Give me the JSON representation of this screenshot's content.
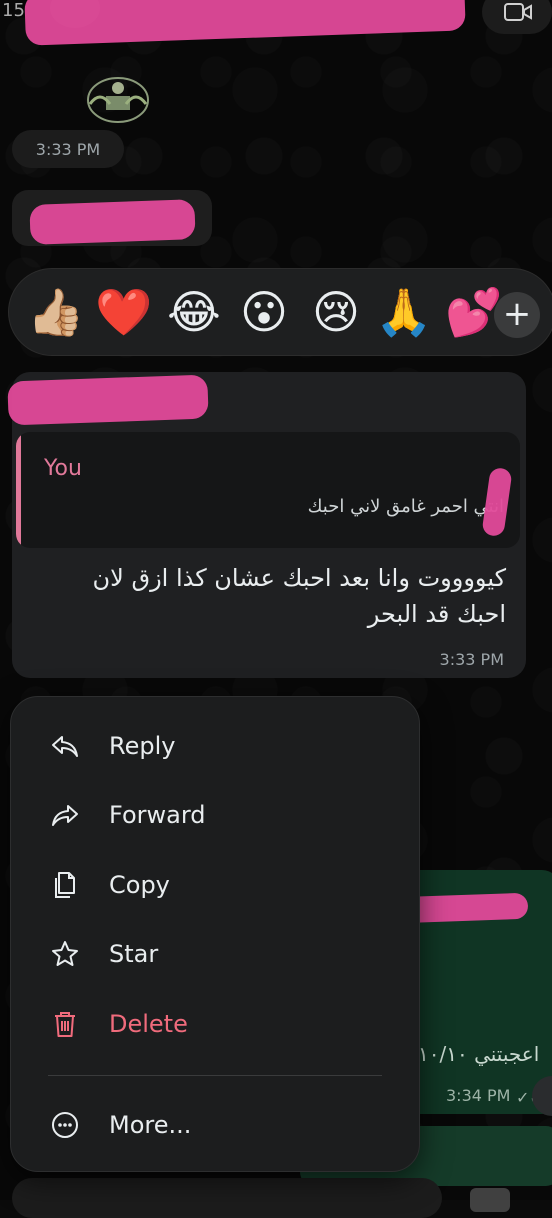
{
  "header": {
    "back_count": "15"
  },
  "chat": {
    "date_time": "3:33 PM"
  },
  "reactions": {
    "emojis": [
      "👍🏼",
      "❤️",
      "😂",
      "😮",
      "😢",
      "🙏",
      "💕"
    ],
    "more_label": "+"
  },
  "message": {
    "quote_author": "You",
    "quote_text": "انتي احمر غامق لاني احبك",
    "text": "كيووووت وانا بعد احبك عشان كذا ازق لان احبك قد البحر",
    "time": "3:33 PM"
  },
  "background_message": {
    "text": "اعجبتني ١٠/١٠",
    "time": "3:34 PM",
    "partial_text": "t"
  },
  "menu": {
    "items": [
      {
        "label": "Reply",
        "icon": "reply-icon"
      },
      {
        "label": "Forward",
        "icon": "forward-icon"
      },
      {
        "label": "Copy",
        "icon": "copy-icon"
      },
      {
        "label": "Star",
        "icon": "star-icon"
      },
      {
        "label": "Delete",
        "icon": "trash-icon"
      },
      {
        "label": "More...",
        "icon": "more-icon"
      }
    ]
  },
  "colors": {
    "accent_pink": "#e1799a",
    "danger": "#f06b7c",
    "menu_bg": "#1c1d1e",
    "bubble_bg": "#1f2022",
    "outgoing_green": "#103524"
  }
}
